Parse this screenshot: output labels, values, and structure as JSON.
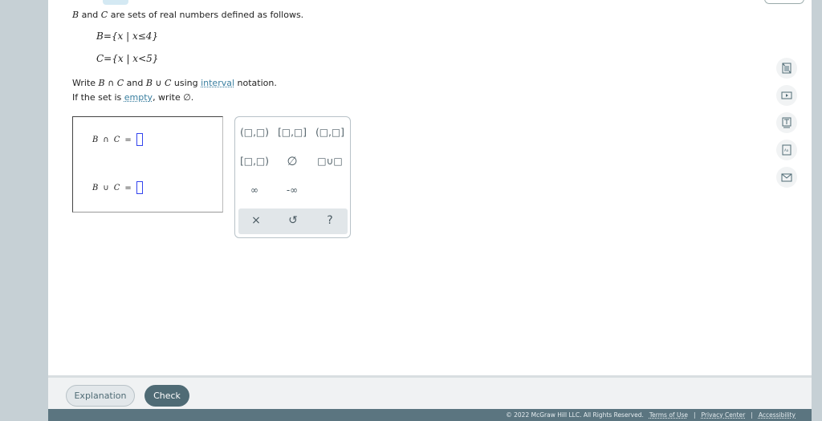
{
  "problem": {
    "intro_var1": "B",
    "intro_and": " and ",
    "intro_var2": "C",
    "intro_rest": " are sets of real numbers defined as follows.",
    "set_b": "B={x | x≤4}",
    "set_c": "C={x | x<5}",
    "instr_write": "Write ",
    "instr_b1": "B",
    "instr_cap": " ∩ ",
    "instr_c1": "C",
    "instr_and": " and ",
    "instr_b2": "B",
    "instr_cup": " ∪ ",
    "instr_c2": "C",
    "instr_using": " using ",
    "instr_link": "interval",
    "instr_end": " notation.",
    "empty_pre": "If the set is ",
    "empty_link": "empty",
    "empty_post": ", write ∅."
  },
  "answers": [
    {
      "label_b": "B",
      "op": "∩",
      "label_c": "C",
      "eq": "=",
      "value": ""
    },
    {
      "label_b": "B",
      "op": "∪",
      "label_c": "C",
      "eq": "=",
      "value": ""
    }
  ],
  "keypad": {
    "keys": [
      "(□,□)",
      "[□,□]",
      "(□,□]",
      "[□,□)",
      "∅",
      "□∪□",
      "∞",
      "-∞"
    ],
    "clear": "×",
    "undo": "↺",
    "help": "?"
  },
  "sidebar_icons": [
    "calculator-icon",
    "video-icon",
    "textbook-icon",
    "glossary-icon",
    "message-icon"
  ],
  "buttons": {
    "explanation": "Explanation",
    "check": "Check"
  },
  "footer": {
    "copyright": "© 2022 McGraw Hill LLC. All Rights Reserved.",
    "terms": "Terms of Use",
    "sep": "|",
    "privacy": "Privacy Center",
    "accessibility": "Accessibility"
  },
  "colors": {
    "check_button": "#4f6b75",
    "footer": "#5b7580",
    "link": "#3a7fa0",
    "answer_slot": "#3344ee"
  }
}
